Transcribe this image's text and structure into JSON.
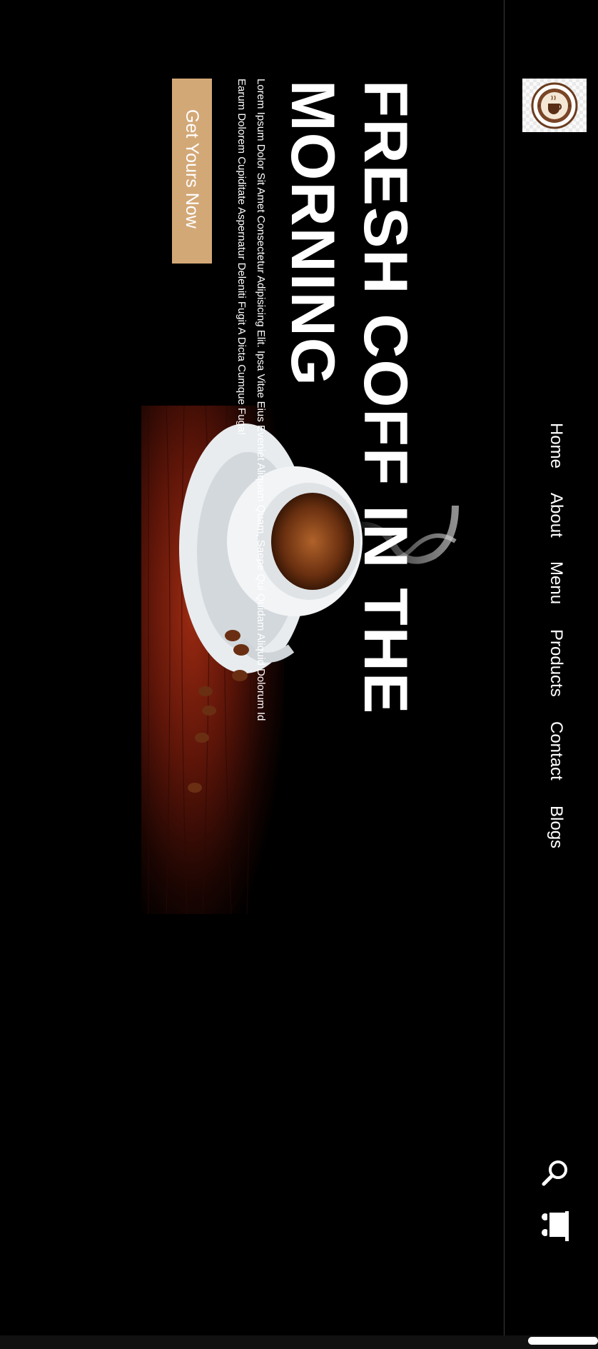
{
  "header": {
    "nav": {
      "home": "Home",
      "about": "About",
      "menu": "Menu",
      "products": "Products",
      "contact": "Contact",
      "blogs": "Blogs"
    },
    "icons": {
      "search": "search-icon",
      "cart": "cart-icon",
      "logo": "coffee-cup-logo"
    }
  },
  "hero": {
    "title_line1": "FRESH COFF IN THE",
    "title_line2": "MORNING",
    "desc_line1": "Lorem Ipsum Dolor Sit Amet Consectetur Adipisicing Elit. Ipsa Vitae Eius Eveniet Aliquam Quam, Saepe Qui Quidam Aliquid Dolorum Id",
    "desc_line2": "Earum Dolorem Cupiditate Aspernatur Deleniti Fugit A Dicta Cumque Fuga!",
    "cta_label": "Get Yours Now"
  },
  "colors": {
    "accent": "#d3a877",
    "background": "#000000",
    "text": "#ffffff"
  }
}
